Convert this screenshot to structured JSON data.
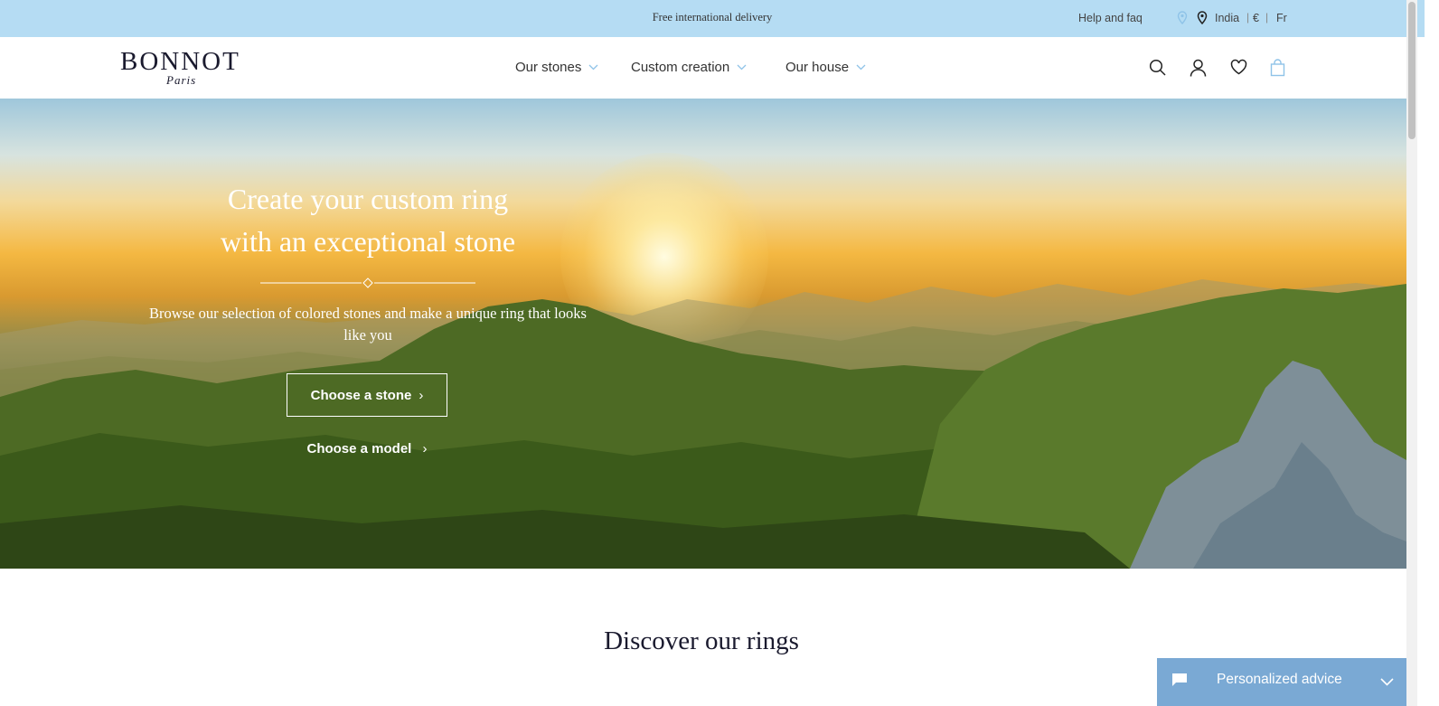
{
  "topbar": {
    "delivery_text": "Free international delivery",
    "help_label": "Help and faq",
    "country": "India",
    "separator": "|",
    "currency": "€",
    "language": "Fr"
  },
  "header": {
    "logo_main": "BONNOT",
    "logo_sub": "Paris",
    "nav": [
      {
        "label": "Our stones"
      },
      {
        "label": "Custom creation"
      },
      {
        "label": "Our house"
      }
    ]
  },
  "hero": {
    "title": "Create your custom ring\nwith an exceptional stone",
    "text": "Browse our selection of colored stones and make a unique ring that looks like you",
    "primary_button": "Choose a stone",
    "secondary_button": "Choose a model",
    "chevron": "›"
  },
  "discover": {
    "heading": "Discover our rings"
  },
  "chat": {
    "label": "Personalized advice"
  },
  "colors": {
    "topbar_bg": "#b5dcf3",
    "chat_bg": "#7aa9d4",
    "accent_light": "#8fc3e8"
  },
  "icons": {
    "search": "search-icon",
    "account": "user-icon",
    "wishlist": "heart-icon",
    "cart": "shopping-bag-icon"
  }
}
